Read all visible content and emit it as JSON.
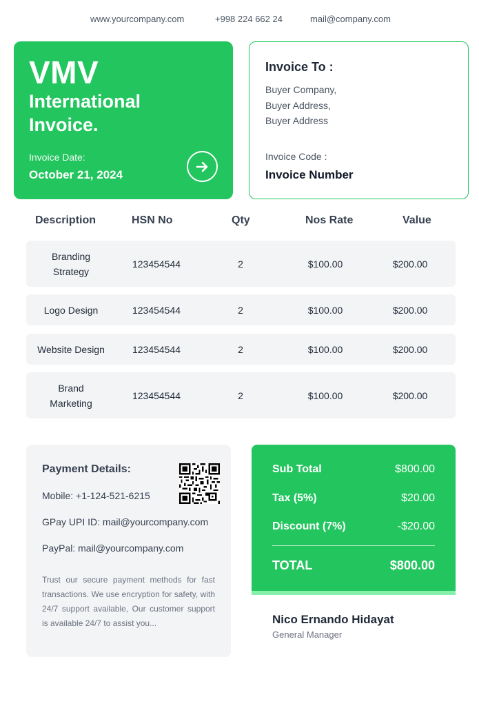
{
  "contact": {
    "website": "www.yourcompany.com",
    "phone": "+998 224 662 24",
    "email": "mail@company.com"
  },
  "header": {
    "brand": "VMV",
    "subtitle": "International Invoice.",
    "date_label": "Invoice Date:",
    "date_value": "October 21, 2024",
    "action_icon": "arrow-right-icon",
    "accent_color": "#22c55e"
  },
  "bill_to": {
    "title": "Invoice To :",
    "company": "Buyer Company,",
    "address_line1": "Buyer Address,",
    "address_line2": "Buyer Address",
    "code_label": "Invoice Code :",
    "code_value": "Invoice Number"
  },
  "table": {
    "headers": [
      "Description",
      "HSN No",
      "Qty",
      "Nos Rate",
      "Value"
    ],
    "rows": [
      {
        "description": "Branding Strategy",
        "hsn": "123454544",
        "qty": "2",
        "rate": "$100.00",
        "value": "$200.00"
      },
      {
        "description": "Logo Design",
        "hsn": "123454544",
        "qty": "2",
        "rate": "$100.00",
        "value": "$200.00"
      },
      {
        "description": "Website Design",
        "hsn": "123454544",
        "qty": "2",
        "rate": "$100.00",
        "value": "$200.00"
      },
      {
        "description": "Brand Marketing",
        "hsn": "123454544",
        "qty": "2",
        "rate": "$100.00",
        "value": "$200.00"
      }
    ]
  },
  "payment": {
    "title": "Payment Details:",
    "mobile": "Mobile: +1-124-521-6215",
    "gpay": "GPay UPI ID: mail@yourcompany.com",
    "paypal": "PayPal: mail@yourcompany.com",
    "note": "Trust our secure payment methods for fast transactions. We use encryption for safety, with 24/7 support available, Our customer support is available 24/7 to assist you...",
    "qr_icon": "qr-code-icon"
  },
  "totals": {
    "subtotal_label": "Sub Total",
    "subtotal_value": "$800.00",
    "tax_label": "Tax (5%)",
    "tax_value": "$20.00",
    "discount_label": "Discount (7%)",
    "discount_value": "-$20.00",
    "total_label": "TOTAL",
    "total_value": "$800.00",
    "strip_color": "#86efac"
  },
  "signature": {
    "name": "Nico Ernando Hidayat",
    "role": "General Manager"
  }
}
